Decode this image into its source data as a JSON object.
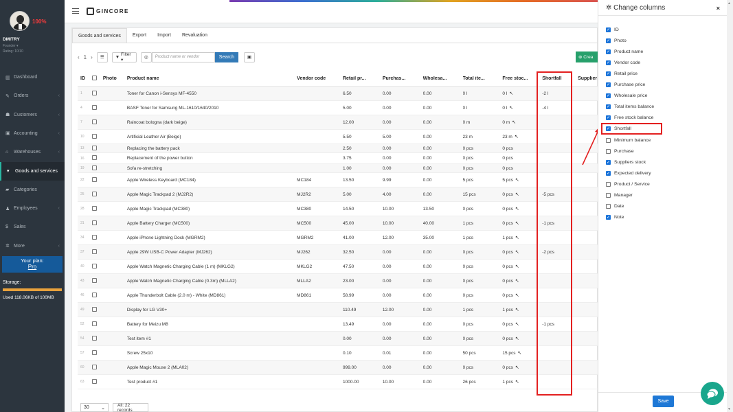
{
  "profile": {
    "progress": "100%",
    "name": "DMITRY",
    "role": "Founder ▾",
    "rating": "Rating: 10/10"
  },
  "nav": [
    {
      "label": "Dashboard",
      "icon": "chart-icon",
      "glyph": "▥",
      "chev": ""
    },
    {
      "label": "Orders",
      "icon": "edit-icon",
      "glyph": "✎",
      "chev": "‹"
    },
    {
      "label": "Customers",
      "icon": "users-icon",
      "glyph": "☗",
      "chev": "‹"
    },
    {
      "label": "Accounting",
      "icon": "money-icon",
      "glyph": "▣",
      "chev": "‹"
    },
    {
      "label": "Warehouses",
      "icon": "warehouse-icon",
      "glyph": "⌂",
      "chev": "‹"
    },
    {
      "label": "Goods and services",
      "icon": "cart-icon",
      "glyph": "▾",
      "chev": "",
      "active": true
    },
    {
      "label": "Categories",
      "icon": "folder-icon",
      "glyph": "▰",
      "chev": ""
    },
    {
      "label": "Employees",
      "icon": "user-icon",
      "glyph": "♟",
      "chev": "‹"
    },
    {
      "label": "Sales",
      "icon": "dollar-icon",
      "glyph": "$",
      "chev": ""
    },
    {
      "label": "More",
      "icon": "gear-icon",
      "glyph": "✲",
      "chev": "‹"
    }
  ],
  "plan": {
    "label": "Your plan:",
    "name": "Pro"
  },
  "storage": {
    "label": "Storage:",
    "used": "Used 118.06KB of 100MB",
    "fraction": 1.0
  },
  "logo": "GINCORE",
  "tabs": [
    "Goods and services",
    "Export",
    "Import",
    "Revaluation"
  ],
  "toolbar": {
    "page": "1",
    "filter_label": "Filter ▾",
    "search_placeholder": "Product name or vendor",
    "search_button": "Search",
    "create_label": "Crea"
  },
  "columns": [
    "ID",
    "Photo",
    "Product name",
    "Vendor code",
    "Retail pr...",
    "Purchas...",
    "Wholesa...",
    "Total ite...",
    "Free stoc...",
    "Shortfall",
    "Supplier"
  ],
  "rows": [
    {
      "id": "1",
      "name": "Toner for Canon i-Sensys MF-4550",
      "vendor": "",
      "retail": "6.50",
      "purchase": "0.00",
      "wholesale": "0.00",
      "total": "0 l",
      "free": "0 l",
      "tool": true,
      "short": "-2 l"
    },
    {
      "id": "4",
      "name": "BASF Toner for Samsung ML-1610/1640/2010",
      "vendor": "",
      "retail": "5.00",
      "purchase": "0.00",
      "wholesale": "0.00",
      "total": "0 l",
      "free": "0 l",
      "tool": true,
      "short": "-4 l"
    },
    {
      "id": "7",
      "name": "Raincoat bologna (dark beige)",
      "vendor": "",
      "retail": "12.00",
      "purchase": "0.00",
      "wholesale": "0.00",
      "total": "0 m",
      "free": "0 m",
      "tool": true,
      "short": ""
    },
    {
      "id": "10",
      "name": "Artificial Leather Air (Beige)",
      "vendor": "",
      "retail": "5.50",
      "purchase": "5.00",
      "wholesale": "0.00",
      "total": "23 m",
      "free": "23 m",
      "tool": true,
      "short": ""
    },
    {
      "id": "13",
      "name": "Replacing the battery pack",
      "vendor": "",
      "retail": "2.50",
      "purchase": "0.00",
      "wholesale": "0.00",
      "total": "0 pcs",
      "free": "0 pcs",
      "tool": false,
      "short": ""
    },
    {
      "id": "16",
      "name": "Replacement of the power button",
      "vendor": "",
      "retail": "3.75",
      "purchase": "0.00",
      "wholesale": "0.00",
      "total": "0 pcs",
      "free": "0 pcs",
      "tool": false,
      "short": ""
    },
    {
      "id": "19",
      "name": "Sofa re-stretching",
      "vendor": "",
      "retail": "1.00",
      "purchase": "0.00",
      "wholesale": "0.00",
      "total": "0 pcs",
      "free": "0 pcs",
      "tool": false,
      "short": ""
    },
    {
      "id": "22",
      "name": "Apple Wireless Keyboard (MC184)",
      "vendor": "MC184",
      "retail": "13.50",
      "purchase": "9.99",
      "wholesale": "0.00",
      "total": "5 pcs",
      "free": "5 pcs",
      "tool": true,
      "short": ""
    },
    {
      "id": "25",
      "name": "Apple Magic Trackpad 2 (MJ2R2)",
      "vendor": "MJ2R2",
      "retail": "5.00",
      "purchase": "4.00",
      "wholesale": "0.00",
      "total": "15 pcs",
      "free": "0 pcs",
      "tool": true,
      "short": "-5 pcs"
    },
    {
      "id": "28",
      "name": "Apple Magic Trackpad (MC380)",
      "vendor": "MC380",
      "retail": "14.50",
      "purchase": "10.00",
      "wholesale": "13.50",
      "total": "0 pcs",
      "free": "0 pcs",
      "tool": true,
      "short": ""
    },
    {
      "id": "31",
      "name": "Apple Battery Charger (MC500)",
      "vendor": "MC500",
      "retail": "45.00",
      "purchase": "10.00",
      "wholesale": "40.00",
      "total": "1 pcs",
      "free": "0 pcs",
      "tool": true,
      "short": "-1 pcs"
    },
    {
      "id": "34",
      "name": "Apple iPhone Lightning Dock (MGRM2)",
      "vendor": "MGRM2",
      "retail": "41.00",
      "purchase": "12.00",
      "wholesale": "35.00",
      "total": "1 pcs",
      "free": "1 pcs",
      "tool": true,
      "short": ""
    },
    {
      "id": "37",
      "name": "Apple 29W USB-C Power Adapter (MJ262)",
      "vendor": "MJ262",
      "retail": "32.50",
      "purchase": "0.00",
      "wholesale": "0.00",
      "total": "0 pcs",
      "free": "0 pcs",
      "tool": true,
      "short": "-2 pcs"
    },
    {
      "id": "40",
      "name": "Apple Watch Magnetic Charging Cable (1 m) (MKLG2)",
      "vendor": "MKLG2",
      "retail": "47.50",
      "purchase": "0.00",
      "wholesale": "0.00",
      "total": "0 pcs",
      "free": "0 pcs",
      "tool": true,
      "short": ""
    },
    {
      "id": "43",
      "name": "Apple Watch Magnetic Charging Cable (0.3m) (MLLA2)",
      "vendor": "MLLA2",
      "retail": "23.00",
      "purchase": "0.00",
      "wholesale": "0.00",
      "total": "0 pcs",
      "free": "0 pcs",
      "tool": true,
      "short": ""
    },
    {
      "id": "46",
      "name": "Apple Thunderbolt Cable (2.0 m) - White (MD861)",
      "vendor": "MD861",
      "retail": "58.99",
      "purchase": "0.00",
      "wholesale": "0.00",
      "total": "0 pcs",
      "free": "0 pcs",
      "tool": true,
      "short": ""
    },
    {
      "id": "49",
      "name": "Display for LG V30+",
      "vendor": "",
      "retail": "110.49",
      "purchase": "12.00",
      "wholesale": "0.00",
      "total": "1 pcs",
      "free": "1 pcs",
      "tool": true,
      "short": ""
    },
    {
      "id": "52",
      "name": "Battery for Meizu M8",
      "vendor": "",
      "retail": "13.49",
      "purchase": "0.00",
      "wholesale": "0.00",
      "total": "0 pcs",
      "free": "0 pcs",
      "tool": true,
      "short": "-1 pcs"
    },
    {
      "id": "54",
      "name": "Test item #1",
      "vendor": "",
      "retail": "0.00",
      "purchase": "0.00",
      "wholesale": "0.00",
      "total": "0 pcs",
      "free": "0 pcs",
      "tool": true,
      "short": ""
    },
    {
      "id": "57",
      "name": "Screw 25x10",
      "vendor": "",
      "retail": "0.10",
      "purchase": "0.01",
      "wholesale": "0.00",
      "total": "50 pcs",
      "free": "15 pcs",
      "tool": true,
      "short": ""
    },
    {
      "id": "60",
      "name": "Apple Magic Mouse 2 (MLA02)",
      "vendor": "",
      "retail": "999.00",
      "purchase": "0.00",
      "wholesale": "0.00",
      "total": "0 pcs",
      "free": "0 pcs",
      "tool": true,
      "short": ""
    },
    {
      "id": "63",
      "name": "Test product #1",
      "vendor": "",
      "retail": "1000.00",
      "purchase": "10.00",
      "wholesale": "0.00",
      "total": "26 pcs",
      "free": "1 pcs",
      "tool": true,
      "short": ""
    }
  ],
  "footer": {
    "page_size": "30",
    "records": "All: 22 records"
  },
  "panel": {
    "title": "Change columns",
    "close": "×",
    "save": "Save",
    "options": [
      {
        "label": "ID",
        "checked": true
      },
      {
        "label": "Photo",
        "checked": true
      },
      {
        "label": "Product name",
        "checked": true
      },
      {
        "label": "Vendor code",
        "checked": true
      },
      {
        "label": "Retail price",
        "checked": true
      },
      {
        "label": "Purchase price",
        "checked": true
      },
      {
        "label": "Wholesale price",
        "checked": true
      },
      {
        "label": "Total items balance",
        "checked": true
      },
      {
        "label": "Free stock balance",
        "checked": true
      },
      {
        "label": "Shortfall",
        "checked": true
      },
      {
        "label": "Minimum balance",
        "checked": false
      },
      {
        "label": "Purchase",
        "checked": false
      },
      {
        "label": "Suppliers stock",
        "checked": true
      },
      {
        "label": "Expected delivery",
        "checked": true
      },
      {
        "label": "Product / Service",
        "checked": false
      },
      {
        "label": "Manager",
        "checked": false
      },
      {
        "label": "Date",
        "checked": false
      },
      {
        "label": "Note",
        "checked": true
      }
    ]
  },
  "colors": {
    "accent": "#1a73d9",
    "highlight": "#e32020",
    "sidebar": "#2c353e",
    "create": "#27a06b"
  }
}
